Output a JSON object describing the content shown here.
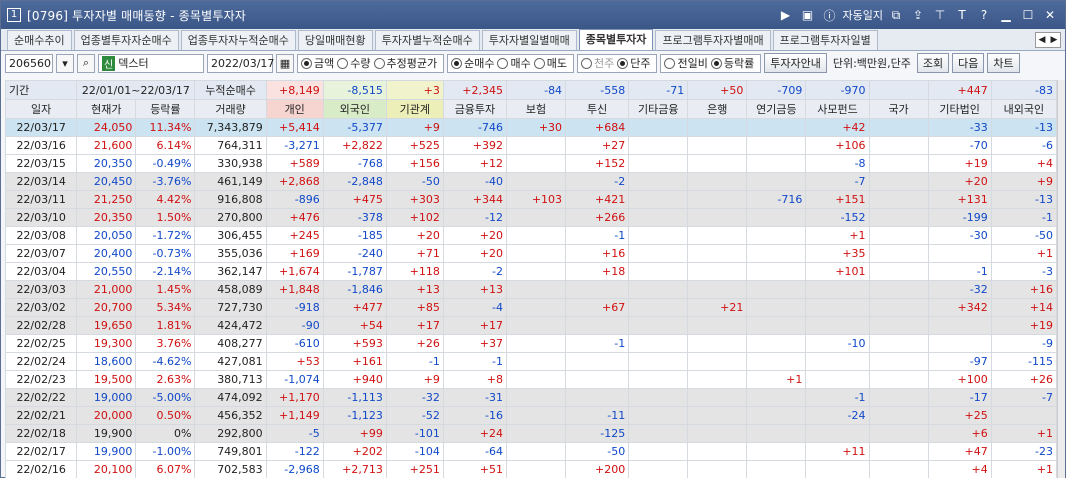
{
  "title": {
    "num": "1",
    "text": "[0796] 투자자별 매매동향 - 종목별투자자",
    "alert": "자동일지"
  },
  "tabs": [
    "순매수추이",
    "업종별투자자순매수",
    "업종투자자누적순매수",
    "당일매매현황",
    "투자자별누적순매수",
    "투자자별일별매매",
    "종목별투자자",
    "프로그램투자자별매매",
    "프로그램투자자일별"
  ],
  "active_tab": 6,
  "controls": {
    "code": "206560",
    "badge": "신",
    "name": "덱스터",
    "date": "2022/03/17",
    "radio1": [
      "금액",
      "수량",
      "추정평균가"
    ],
    "radio2": [
      "순매수",
      "매수",
      "매도"
    ],
    "radio3": [
      "천주",
      "단주"
    ],
    "radio4": [
      "전일비",
      "등락률"
    ],
    "guide": "투자자안내",
    "unit": "단위:백만원,단주",
    "query": "조회",
    "next": "다음",
    "chart": "차트",
    "period_label": "기간",
    "from": "22/01/01",
    "tilde": "~",
    "to": "22/03/17",
    "cum_label": "누적순매수"
  },
  "sums": [
    "+8,149",
    "-8,515",
    "+3",
    "+2,345",
    "-84",
    "-558",
    "-71",
    "+50",
    "-709",
    "-970",
    "",
    "+447",
    "-83"
  ],
  "headers": [
    "일자",
    "현재가",
    "등락률",
    "거래량",
    "개인",
    "외국인",
    "기관계",
    "금융투자",
    "보험",
    "투신",
    "기타금융",
    "은행",
    "연기금등",
    "사모펀드",
    "국가",
    "기타법인",
    "내외국인"
  ],
  "rows": [
    [
      "22/03/17",
      "24,050",
      "11.34%",
      "7,343,879",
      "+5,414",
      "-5,377",
      "+9",
      "-746",
      "+30",
      "+684",
      "",
      "",
      "",
      "+42",
      "",
      "-33",
      "-13"
    ],
    [
      "22/03/16",
      "21,600",
      "6.14%",
      "764,311",
      "-3,271",
      "+2,822",
      "+525",
      "+392",
      "",
      "+27",
      "",
      "",
      "",
      "+106",
      "",
      "-70",
      "-6"
    ],
    [
      "22/03/15",
      "20,350",
      "-0.49%",
      "330,938",
      "+589",
      "-768",
      "+156",
      "+12",
      "",
      "+152",
      "",
      "",
      "",
      "-8",
      "",
      "+19",
      "+4"
    ],
    [
      "22/03/14",
      "20,450",
      "-3.76%",
      "461,149",
      "+2,868",
      "-2,848",
      "-50",
      "-40",
      "",
      "-2",
      "",
      "",
      "",
      "-7",
      "",
      "+20",
      "+9"
    ],
    [
      "22/03/11",
      "21,250",
      "4.42%",
      "916,808",
      "-896",
      "+475",
      "+303",
      "+344",
      "+103",
      "+421",
      "",
      "",
      "-716",
      "+151",
      "",
      "+131",
      "-13"
    ],
    [
      "22/03/10",
      "20,350",
      "1.50%",
      "270,800",
      "+476",
      "-378",
      "+102",
      "-12",
      "",
      "+266",
      "",
      "",
      "",
      "-152",
      "",
      "-199",
      "-1"
    ],
    [
      "22/03/08",
      "20,050",
      "-1.72%",
      "306,455",
      "+245",
      "-185",
      "+20",
      "+20",
      "",
      "-1",
      "",
      "",
      "",
      "+1",
      "",
      "-30",
      "-50"
    ],
    [
      "22/03/07",
      "20,400",
      "-0.73%",
      "355,036",
      "+169",
      "-240",
      "+71",
      "+20",
      "",
      "+16",
      "",
      "",
      "",
      "+35",
      "",
      "",
      "+1"
    ],
    [
      "22/03/04",
      "20,550",
      "-2.14%",
      "362,147",
      "+1,674",
      "-1,787",
      "+118",
      "-2",
      "",
      "+18",
      "",
      "",
      "",
      "+101",
      "",
      "-1",
      "-3"
    ],
    [
      "22/03/03",
      "21,000",
      "1.45%",
      "458,089",
      "+1,848",
      "-1,846",
      "+13",
      "+13",
      "",
      "",
      "",
      "",
      "",
      "",
      "",
      "-32",
      "+16"
    ],
    [
      "22/03/02",
      "20,700",
      "5.34%",
      "727,730",
      "-918",
      "+477",
      "+85",
      "-4",
      "",
      "+67",
      "",
      "+21",
      "",
      "",
      "",
      "+342",
      "+14"
    ],
    [
      "22/02/28",
      "19,650",
      "1.81%",
      "424,472",
      "-90",
      "+54",
      "+17",
      "+17",
      "",
      "",
      "",
      "",
      "",
      "",
      "",
      "",
      "+19"
    ],
    [
      "22/02/25",
      "19,300",
      "3.76%",
      "408,277",
      "-610",
      "+593",
      "+26",
      "+37",
      "",
      "-1",
      "",
      "",
      "",
      "-10",
      "",
      "",
      "-9"
    ],
    [
      "22/02/24",
      "18,600",
      "-4.62%",
      "427,081",
      "+53",
      "+161",
      "-1",
      "-1",
      "",
      "",
      "",
      "",
      "",
      "",
      "",
      "-97",
      "-115"
    ],
    [
      "22/02/23",
      "19,500",
      "2.63%",
      "380,713",
      "-1,074",
      "+940",
      "+9",
      "+8",
      "",
      "",
      "",
      "",
      "+1",
      "",
      "",
      "+100",
      "+26"
    ],
    [
      "22/02/22",
      "19,000",
      "-5.00%",
      "474,092",
      "+1,170",
      "-1,113",
      "-32",
      "-31",
      "",
      "",
      "",
      "",
      "",
      "-1",
      "",
      "-17",
      "-7"
    ],
    [
      "22/02/21",
      "20,000",
      "0.50%",
      "456,352",
      "+1,149",
      "-1,123",
      "-52",
      "-16",
      "",
      "-11",
      "",
      "",
      "",
      "-24",
      "",
      "+25",
      ""
    ],
    [
      "22/02/18",
      "19,900",
      "0%",
      "292,800",
      "-5",
      "+99",
      "-101",
      "+24",
      "",
      "-125",
      "",
      "",
      "",
      "",
      "",
      "+6",
      "+1"
    ],
    [
      "22/02/17",
      "19,900",
      "-1.00%",
      "749,801",
      "-122",
      "+202",
      "-104",
      "-64",
      "",
      "-50",
      "",
      "",
      "",
      "+11",
      "",
      "+47",
      "-23"
    ],
    [
      "22/02/16",
      "20,100",
      "6.07%",
      "702,583",
      "-2,968",
      "+2,713",
      "+251",
      "+51",
      "",
      "+200",
      "",
      "",
      "",
      "",
      "",
      "+4",
      "+1"
    ]
  ],
  "row_style": [
    "sel",
    "",
    "",
    "gray",
    "gray",
    "gray",
    "",
    "",
    "",
    "gray",
    "gray",
    "gray",
    "",
    "",
    "",
    "gray",
    "gray",
    "gray",
    "",
    ""
  ]
}
